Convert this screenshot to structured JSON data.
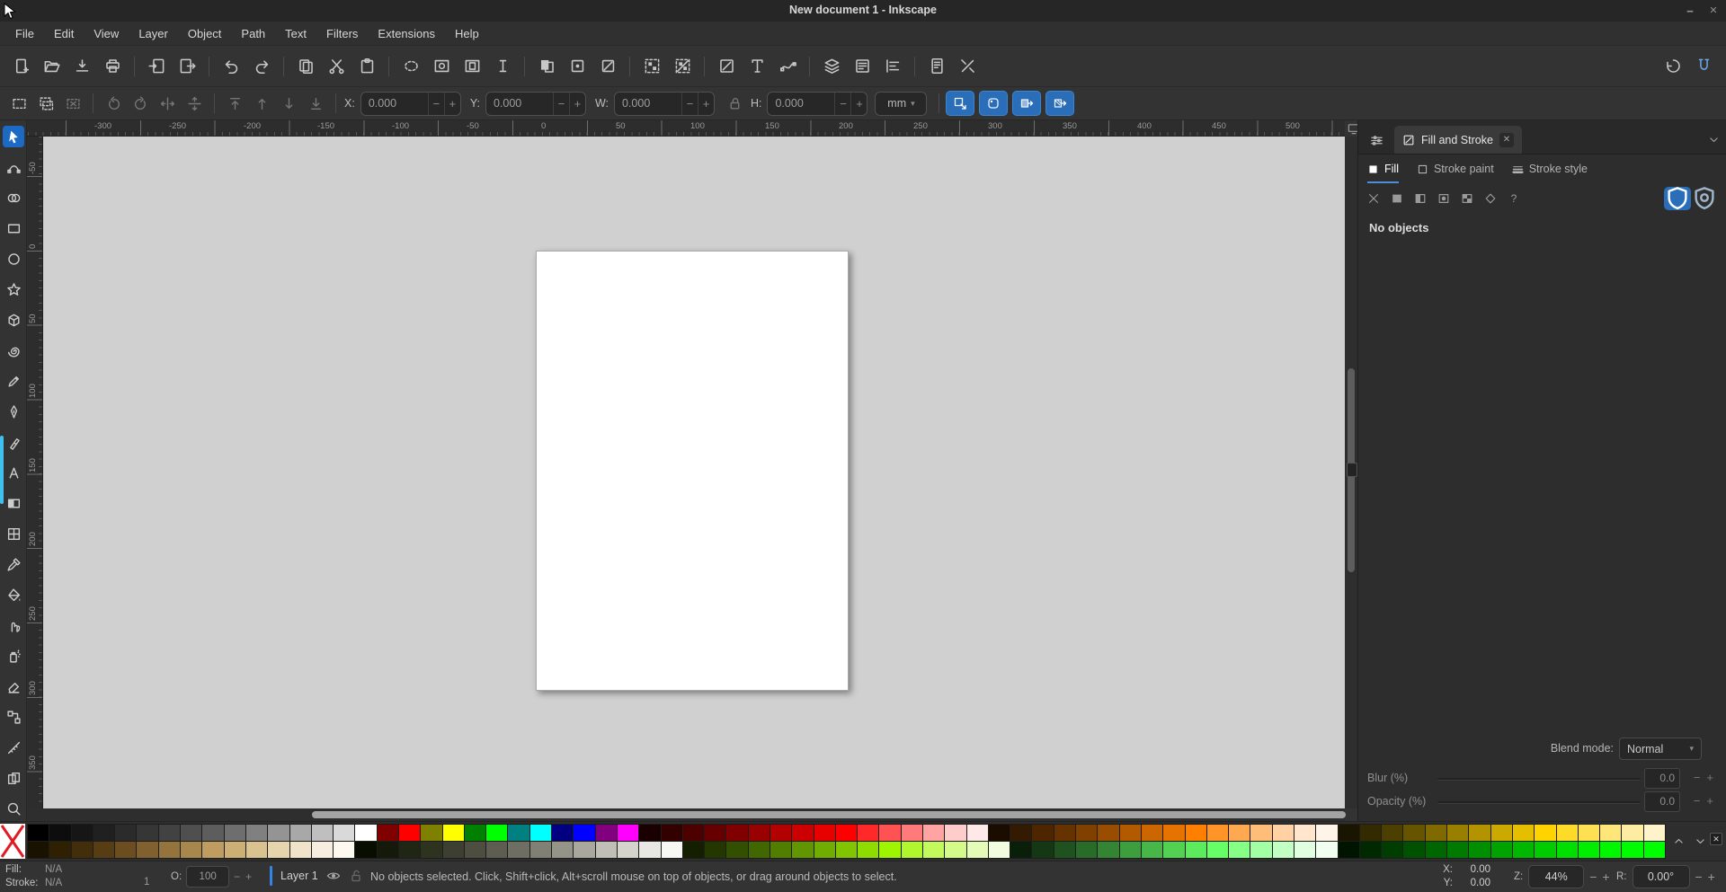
{
  "window": {
    "title": "New document 1 - Inkscape",
    "minimize_label": "🗕",
    "close_label": "✕"
  },
  "menu_bar": {
    "items": [
      "File",
      "Edit",
      "View",
      "Layer",
      "Object",
      "Path",
      "Text",
      "Filters",
      "Extensions",
      "Help"
    ]
  },
  "command_bar": {
    "groups": [
      [
        "document-new",
        "document-open",
        "document-save",
        "document-print"
      ],
      [
        "import",
        "export"
      ],
      [
        "undo",
        "redo"
      ],
      [
        "copy",
        "cut",
        "paste"
      ],
      [
        "zoom-drawing",
        "zoom-selection",
        "zoom-page",
        "zoom-1to1"
      ],
      [
        "duplicate",
        "clone",
        "unlink-clone"
      ],
      [
        "group-objects",
        "ungroup-objects"
      ],
      [
        "fill-stroke-dialog",
        "text-dialog",
        "path-effects-dialog"
      ],
      [
        "layers-dialog",
        "object-properties-dialog",
        "align-distribute-dialog"
      ],
      [
        "document-properties",
        "preferences"
      ]
    ],
    "right_icons": [
      "snap-controls",
      "snap-toggle"
    ]
  },
  "tool_controls": {
    "buttons_left": [
      "select-all",
      "select-all-layers",
      "deselect"
    ],
    "buttons_transform": [
      "rotate-ccw",
      "rotate-cw",
      "flip-horizontal",
      "flip-vertical"
    ],
    "buttons_z": [
      "raise-to-top",
      "raise",
      "lower",
      "lower-to-bottom"
    ],
    "fields": [
      {
        "label": "X:",
        "value": "0.000"
      },
      {
        "label": "Y:",
        "value": "0.000"
      },
      {
        "label": "W:",
        "value": "0.000"
      },
      {
        "label": "H:",
        "value": "0.000"
      }
    ],
    "stepper_minus": "−",
    "stepper_plus": "+",
    "unit": "mm",
    "toggles": [
      "scale-stroke",
      "scale-corners",
      "move-gradients",
      "move-patterns"
    ]
  },
  "toolbox": {
    "tools": [
      {
        "name": "selector",
        "active": true
      },
      {
        "name": "node"
      },
      {
        "name": "shape-builder"
      },
      {
        "name": "rectangle"
      },
      {
        "name": "ellipse"
      },
      {
        "name": "star"
      },
      {
        "name": "box-3d"
      },
      {
        "name": "spiral"
      },
      {
        "name": "pencil"
      },
      {
        "name": "pen"
      },
      {
        "name": "calligraphy"
      },
      {
        "name": "text"
      },
      {
        "name": "gradient"
      },
      {
        "name": "mesh"
      },
      {
        "name": "dropper"
      },
      {
        "name": "paint-bucket"
      },
      {
        "name": "tweak"
      },
      {
        "name": "spray"
      },
      {
        "name": "eraser"
      },
      {
        "name": "connector"
      },
      {
        "name": "measure"
      },
      {
        "name": "pages"
      },
      {
        "name": "zoom-tool"
      },
      {
        "name": "xml-editor"
      }
    ]
  },
  "rulers": {
    "horizontal_labels": [
      "-300",
      "-250",
      "-200",
      "-150",
      "-100",
      "-50",
      "0",
      "50",
      "100",
      "150",
      "200",
      "250",
      "300",
      "350",
      "400",
      "450",
      "500"
    ],
    "vertical_labels": [
      "-50",
      "0",
      "50",
      "100",
      "150",
      "200",
      "250",
      "300",
      "350"
    ]
  },
  "canvas": {
    "background": "#d0d0d0",
    "page_color": "#ffffff"
  },
  "dock": {
    "tab_title": "Fill and Stroke",
    "tabs": [
      {
        "label": "Fill",
        "active": true
      },
      {
        "label": "Stroke paint",
        "active": false
      },
      {
        "label": "Stroke style",
        "active": false
      }
    ],
    "paint_buttons": [
      "no-paint",
      "flat-color",
      "linear-gradient",
      "radial-gradient",
      "pattern",
      "swatch-paint",
      "unknown-paint"
    ],
    "unknown_glyph": "?",
    "fill_rule_buttons": [
      {
        "name": "fill-rule-nonzero",
        "active": true
      },
      {
        "name": "fill-rule-evenodd",
        "active": false
      }
    ],
    "status": "No objects",
    "blend_label": "Blend mode:",
    "blend_value": "Normal",
    "blur_label": "Blur (%)",
    "blur_value": "0.0",
    "opacity_label": "Opacity (%)",
    "opacity_value": "0.0"
  },
  "palette": {
    "row1": [
      "#000000",
      "#0d0d0d",
      "#161616",
      "#202020",
      "#2b2b2b",
      "#363636",
      "#424242",
      "#4f4f4f",
      "#5d5d5d",
      "#6e6e6e",
      "#808080",
      "#949494",
      "#a8a8a8",
      "#bfbfbf",
      "#d9d9d9",
      "#ffffff",
      "#800000",
      "#ff0000",
      "#808000",
      "#ffff00",
      "#008000",
      "#00ff00",
      "#008080",
      "#00ffff",
      "#000080",
      "#0000ff",
      "#800080",
      "#ff00ff",
      "#1a0000",
      "#330000",
      "#4d0000",
      "#660000",
      "#800000",
      "#990000",
      "#b30000",
      "#cc0000",
      "#e60000",
      "#ff0000",
      "#ff2929",
      "#ff5252",
      "#ff7a7a",
      "#ffa3a3",
      "#ffcccc",
      "#ffe8e8",
      "#1a0d00",
      "#331a00",
      "#4d2600",
      "#663300",
      "#804000",
      "#994d00",
      "#b35900",
      "#cc6600",
      "#e67300",
      "#ff8000",
      "#ff9429",
      "#ffa852",
      "#ffbd7a",
      "#ffd1a3",
      "#ffe6cc",
      "#fff4e8",
      "#1a1500",
      "#332a00",
      "#4d3f00",
      "#665400",
      "#806a00",
      "#997f00",
      "#b39400",
      "#cca900",
      "#e6be00",
      "#ffd300",
      "#ffdb29",
      "#ffe052",
      "#ffe67a",
      "#ffeca3",
      "#fff3cc"
    ],
    "row2": [
      "#1a1200",
      "#2e2000",
      "#422e0a",
      "#573d14",
      "#6b4d1f",
      "#80602e",
      "#94733d",
      "#a8874d",
      "#bf9c60",
      "#ccaf75",
      "#d9c28f",
      "#e6d4ad",
      "#f0e3c9",
      "#f7eee0",
      "#fdf8f0",
      "#080d00",
      "#14190a",
      "#202614",
      "#2e3320",
      "#3d4030",
      "#4d4d40",
      "#5d5d52",
      "#6e6e63",
      "#808075",
      "#949489",
      "#a8a89e",
      "#bfbfb5",
      "#d4d4cc",
      "#e8e8e2",
      "#f7f7f4",
      "#141f00",
      "#243700",
      "#334f00",
      "#426600",
      "#527e00",
      "#619600",
      "#70ad00",
      "#80c500",
      "#8fdd00",
      "#9ff500",
      "#b0f72e",
      "#c2f95c",
      "#d4fa8a",
      "#e5fcb8",
      "#f2fde0",
      "#0a1f0a",
      "#143814",
      "#1f521f",
      "#296b29",
      "#338533",
      "#3d9e3d",
      "#47b847",
      "#52d152",
      "#5ceb5c",
      "#66ff66",
      "#85ff85",
      "#a3ffa3",
      "#c2ffc2",
      "#e0ffe0",
      "#f0fff0",
      "#001400",
      "#002900",
      "#003d00",
      "#005200",
      "#006600",
      "#007a00",
      "#008f00",
      "#00a300",
      "#00b800",
      "#00cc00",
      "#00e000",
      "#00ee00",
      "#00f700",
      "#00fc00",
      "#00ff00"
    ]
  },
  "status_bar": {
    "fill_label": "Fill:",
    "fill_value": "N/A",
    "stroke_label": "Stroke:",
    "stroke_value": "N/A",
    "stroke_width": "1",
    "opacity_label": "O:",
    "opacity_value": "100",
    "layer_name": "Layer 1",
    "message": "No objects selected. Click, Shift+click, Alt+scroll mouse on top of objects, or drag around objects to select.",
    "x_label": "X:",
    "x_value": "0.00",
    "y_label": "Y:",
    "y_value": "0.00",
    "zoom_label": "Z:",
    "zoom_value": "44%",
    "rotation_label": "R:",
    "rotation_value": "0.00°",
    "stepper_minus": "−",
    "stepper_plus": "+"
  },
  "accent_colors": {
    "selection_blue": "#1c6ac4",
    "toggle_blue": "#2a6db8",
    "indicator_cyan": "#3fc1f0"
  }
}
